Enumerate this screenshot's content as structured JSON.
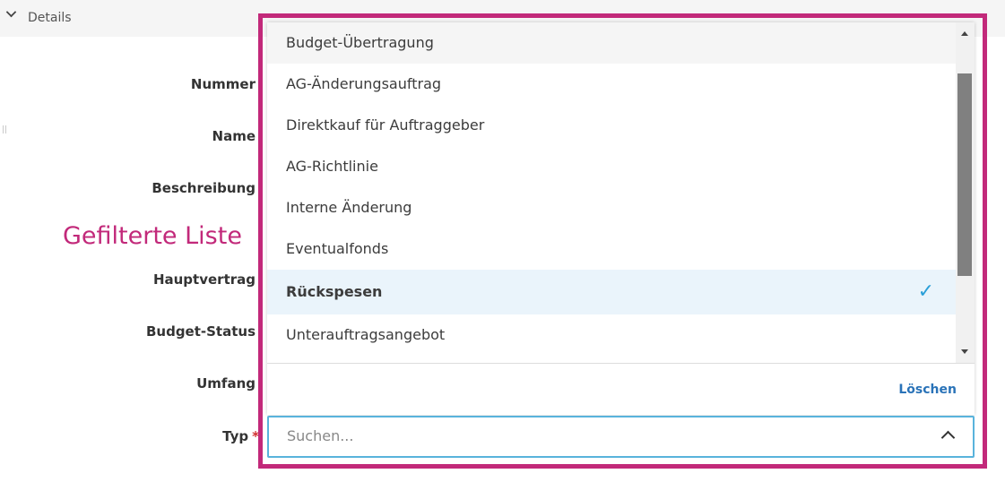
{
  "section": {
    "title": "Details"
  },
  "form": {
    "labels": [
      "Nummer",
      "Name",
      "Beschreibung",
      "Hauptvertrag",
      "Budget-Status",
      "Umfang",
      "Typ"
    ],
    "required_mark": "*"
  },
  "annotation": "Gefilterte Liste",
  "dropdown": {
    "items": [
      "Budget-Übertragung",
      "AG-Änderungsauftrag",
      "Direktkauf für Auftraggeber",
      "AG-Richtlinie",
      "Interne Änderung",
      "Eventualfonds",
      "Rückspesen",
      "Unterauftragsangebot"
    ],
    "selected": "Rückspesen",
    "clear_label": "Löschen",
    "search_placeholder": "Suchen..."
  },
  "colors": {
    "annotation": "#c2297a",
    "accent": "#2a9fd8",
    "link": "#2a73b8"
  }
}
